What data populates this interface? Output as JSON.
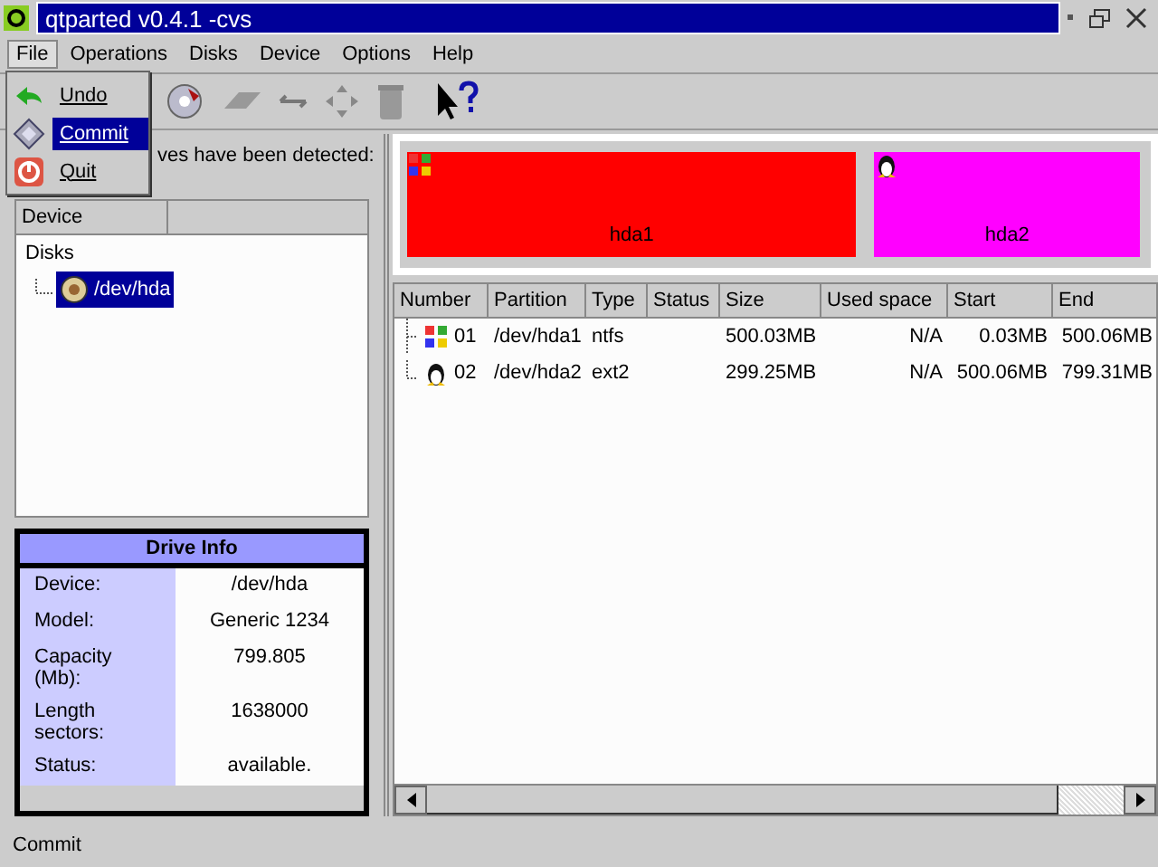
{
  "window": {
    "title": "qtparted v0.4.1 -cvs"
  },
  "menu_bar": [
    {
      "label": "File",
      "selected": true
    },
    {
      "label": "Operations",
      "selected": false
    },
    {
      "label": "Disks",
      "selected": false
    },
    {
      "label": "Device",
      "selected": false
    },
    {
      "label": "Options",
      "selected": false
    },
    {
      "label": "Help",
      "selected": false
    }
  ],
  "file_menu": [
    {
      "label": "Undo",
      "kind": "undo",
      "selected": false
    },
    {
      "label": "Commit",
      "kind": "commit",
      "selected": true
    },
    {
      "label": "Quit",
      "kind": "quit",
      "selected": false
    }
  ],
  "left_panel": {
    "caption": "ves have been detected:",
    "column": "Device",
    "tree": [
      {
        "label": "Disks",
        "selected": false,
        "children": [
          {
            "label": "/dev/hda",
            "selected": true
          }
        ]
      }
    ]
  },
  "drive_info": {
    "title": "Drive Info",
    "rows": [
      {
        "label": "Device:",
        "value": "/dev/hda"
      },
      {
        "label": "Model:",
        "value": "Generic 1234"
      },
      {
        "label": "Capacity (Mb):",
        "value": "799.805"
      },
      {
        "label": "Length sectors:",
        "value": "1638000"
      },
      {
        "label": "Status:",
        "value": "available."
      }
    ]
  },
  "disk_map": [
    {
      "label": "hda1",
      "kind": "windows",
      "color": "#ff0000"
    },
    {
      "label": "hda2",
      "kind": "linux",
      "color": "#ff00ff"
    }
  ],
  "partition_table": {
    "columns": [
      "Number",
      "Partition",
      "Type",
      "Status",
      "Size",
      "Used space",
      "Start",
      "End"
    ],
    "rows": [
      {
        "kind": "windows",
        "number": "01",
        "partition": "/dev/hda1",
        "type": "ntfs",
        "size": "500.03MB",
        "used_space": "N/A",
        "start": "0.03MB",
        "end": "500.06MB"
      },
      {
        "kind": "linux",
        "number": "02",
        "partition": "/dev/hda2",
        "type": "ext2",
        "size": "299.25MB",
        "used_space": "N/A",
        "start": "500.06MB",
        "end": "799.31MB"
      }
    ]
  },
  "status_bar": "Commit"
}
